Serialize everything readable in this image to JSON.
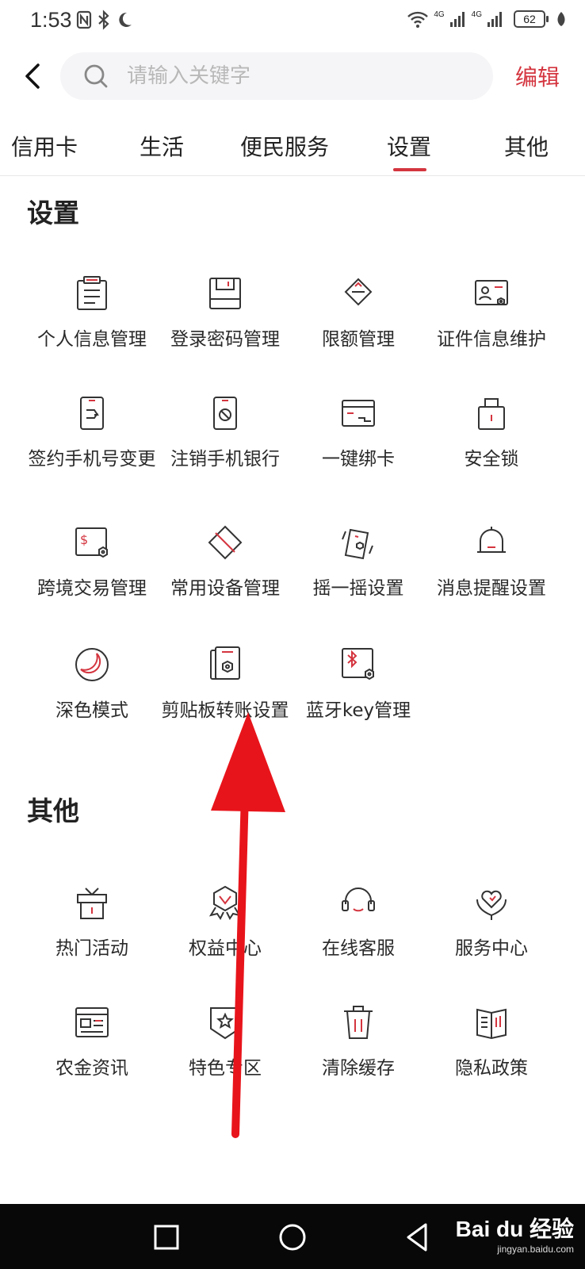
{
  "status_bar": {
    "time": "1:53",
    "network_1": "4G",
    "network_2": "4G",
    "battery": "62"
  },
  "header": {
    "search_placeholder": "请输入关键字",
    "edit_label": "编辑"
  },
  "tabs": [
    {
      "label": "信用卡"
    },
    {
      "label": "生活"
    },
    {
      "label": "便民服务"
    },
    {
      "label": "设置",
      "active": true
    },
    {
      "label": "其他"
    }
  ],
  "sections": {
    "settings": {
      "title": "设置",
      "items": [
        {
          "label": "个人信息管理",
          "icon": "personal-info-icon"
        },
        {
          "label": "登录密码管理",
          "icon": "login-password-icon"
        },
        {
          "label": "限额管理",
          "icon": "limit-icon"
        },
        {
          "label": "证件信息维护",
          "icon": "id-card-icon"
        },
        {
          "label": "签约手机号变更",
          "icon": "phone-change-icon"
        },
        {
          "label": "注销手机银行",
          "icon": "cancel-phone-bank-icon"
        },
        {
          "label": "一键绑卡",
          "icon": "bind-card-icon"
        },
        {
          "label": "安全锁",
          "icon": "lock-icon"
        },
        {
          "label": "跨境交易管理",
          "icon": "cross-border-icon"
        },
        {
          "label": "常用设备管理",
          "icon": "device-icon"
        },
        {
          "label": "摇一摇设置",
          "icon": "shake-icon"
        },
        {
          "label": "消息提醒设置",
          "icon": "bell-icon"
        },
        {
          "label": "深色模式",
          "icon": "dark-mode-icon"
        },
        {
          "label": "剪贴板转账设置",
          "icon": "clipboard-icon"
        },
        {
          "label": "蓝牙key管理",
          "icon": "bluetooth-key-icon"
        }
      ]
    },
    "other": {
      "title": "其他",
      "items": [
        {
          "label": "热门活动",
          "icon": "gift-icon"
        },
        {
          "label": "权益中心",
          "icon": "badge-icon"
        },
        {
          "label": "在线客服",
          "icon": "headset-icon"
        },
        {
          "label": "服务中心",
          "icon": "heart-hand-icon"
        },
        {
          "label": "农金资讯",
          "icon": "news-icon"
        },
        {
          "label": "特色专区",
          "icon": "star-shield-icon"
        },
        {
          "label": "清除缓存",
          "icon": "trash-icon"
        },
        {
          "label": "隐私政策",
          "icon": "book-icon"
        }
      ]
    }
  },
  "watermark": {
    "logo": "Bai du 经验",
    "url": "jingyan.baidu.com"
  },
  "colors": {
    "accent": "#d4353f",
    "icon_stroke": "#333333",
    "annotation_arrow": "#e8141b"
  }
}
